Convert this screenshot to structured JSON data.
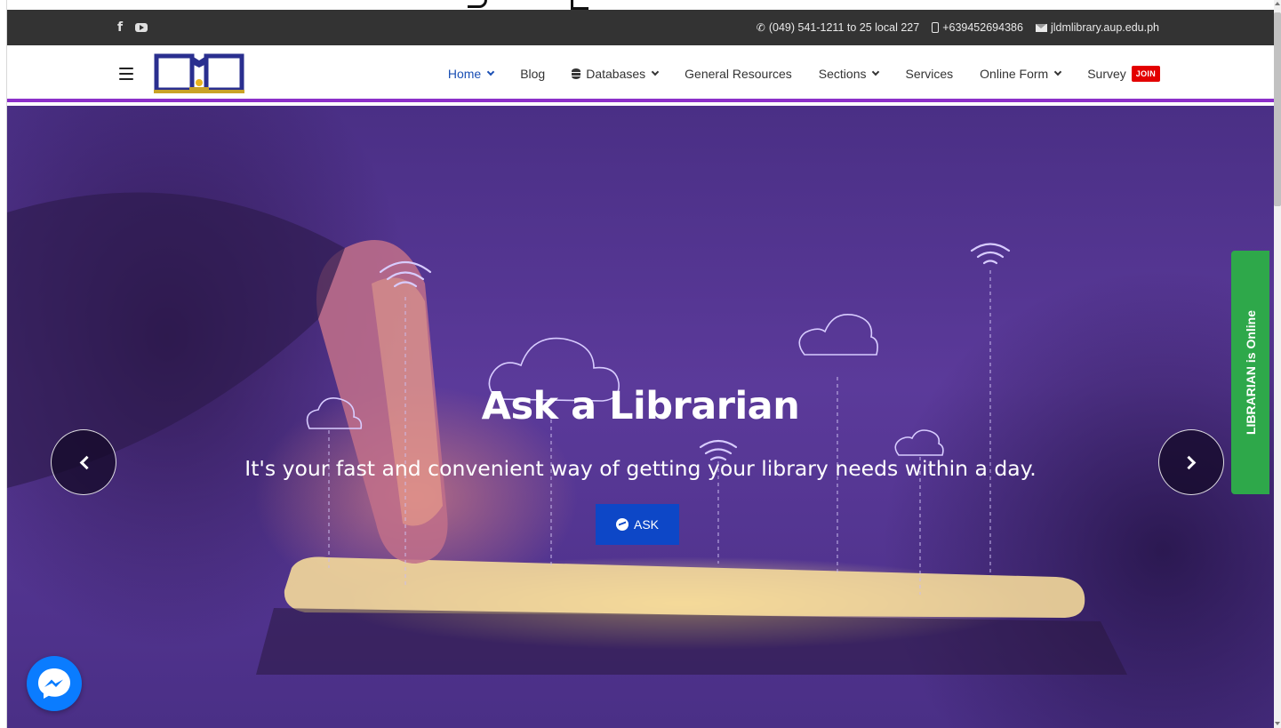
{
  "topbar": {
    "social": [
      {
        "icon": "facebook-icon",
        "label": "f"
      },
      {
        "icon": "youtube-icon"
      }
    ],
    "phone": "(049) 541-1211 to 25 local 227",
    "mobile": "+639452694386",
    "email": "jldmlibrary.aup.edu.ph"
  },
  "navbar": {
    "logo_alt": "library-logo",
    "items": [
      {
        "label": "Home",
        "dropdown": true,
        "active": true
      },
      {
        "label": "Blog",
        "dropdown": false
      },
      {
        "label": "Databases",
        "dropdown": true,
        "icon": "database-icon"
      },
      {
        "label": "General Resources",
        "dropdown": false
      },
      {
        "label": "Sections",
        "dropdown": true
      },
      {
        "label": "Services",
        "dropdown": false
      },
      {
        "label": "Online Form",
        "dropdown": true
      },
      {
        "label": "Survey",
        "dropdown": false,
        "badge": "JOIN"
      }
    ]
  },
  "hero": {
    "title": "Ask a Librarian",
    "subtitle": "It's your fast and convenient way of getting your library needs within a day.",
    "button": "ASK"
  },
  "librarian_tab": "LIBRARIAN is Online",
  "colors": {
    "accent_purple": "#8b2fc9",
    "ask_button": "#0d47c7",
    "online_tab": "#2ea84a",
    "join_badge": "#e30000",
    "active_nav": "#1a4fb4"
  }
}
